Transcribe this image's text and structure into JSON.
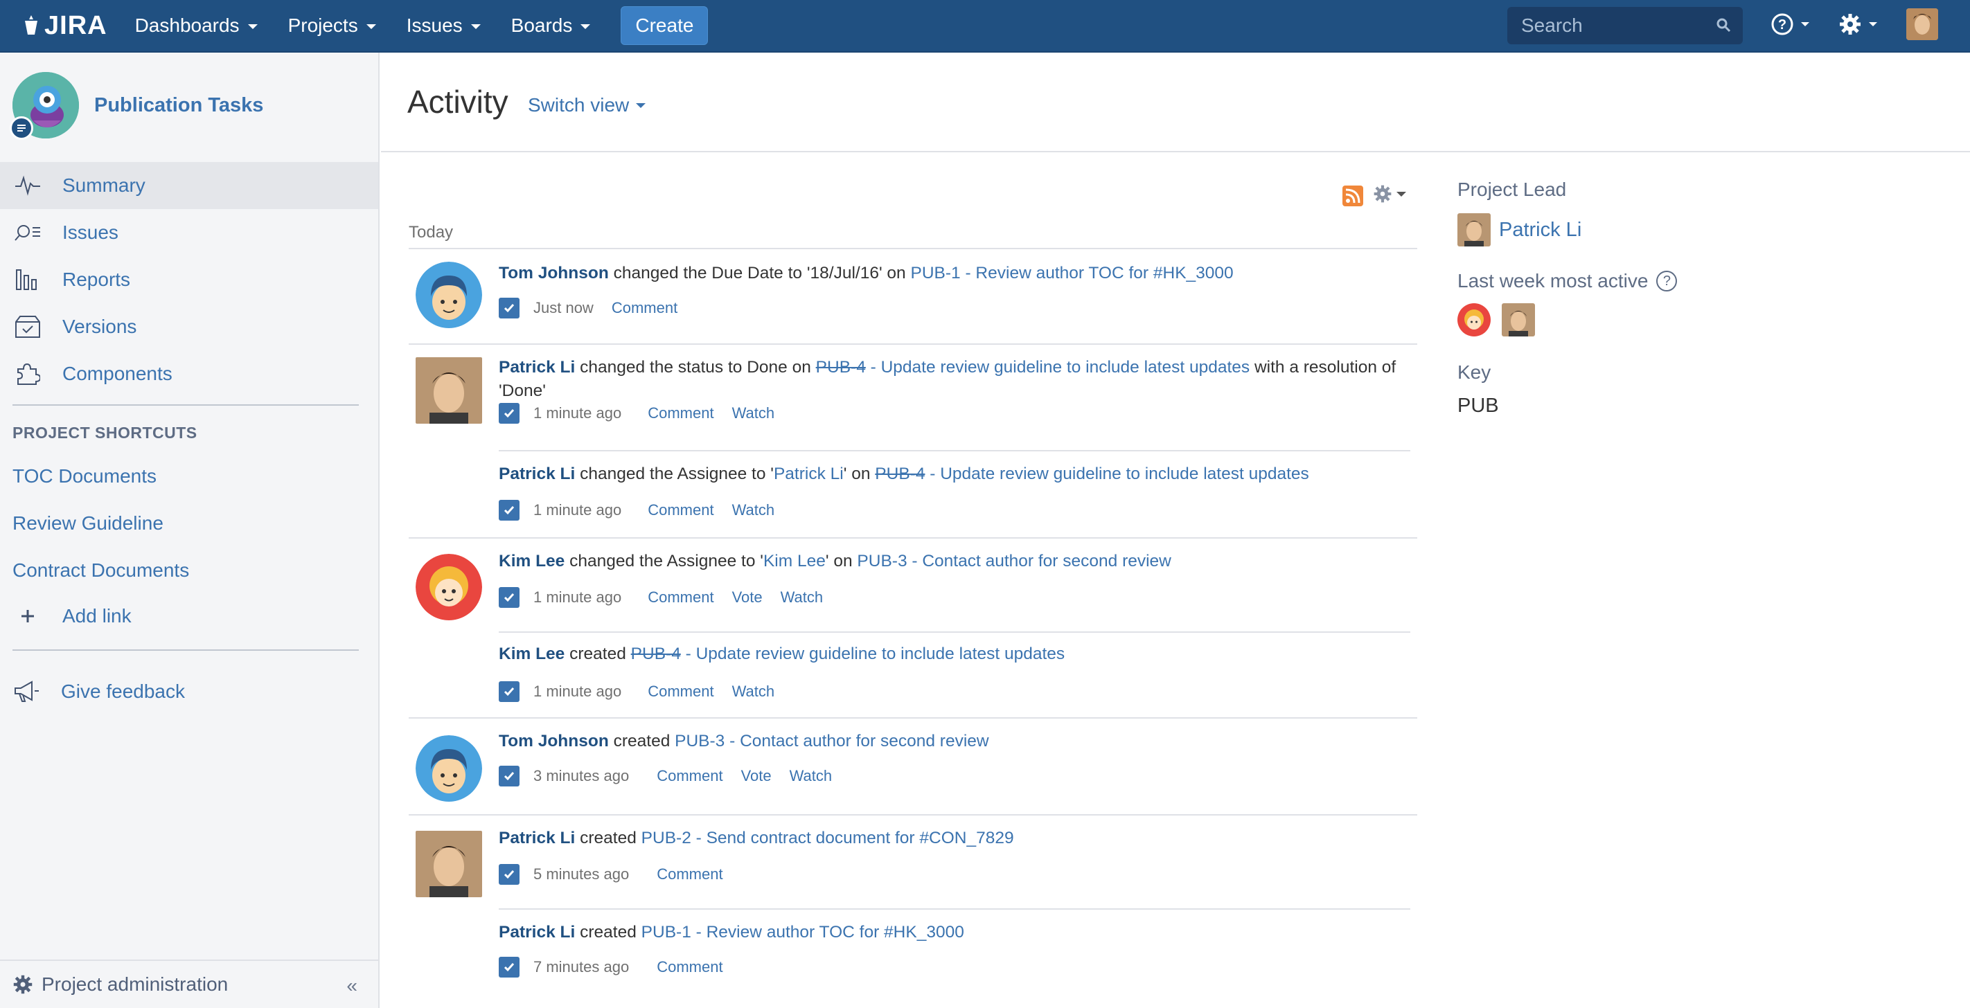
{
  "topbar": {
    "logo_text": "JIRA",
    "nav": [
      {
        "label": "Dashboards"
      },
      {
        "label": "Projects"
      },
      {
        "label": "Issues"
      },
      {
        "label": "Boards"
      }
    ],
    "create_label": "Create",
    "search_placeholder": "Search",
    "colors": {
      "bar": "#205081",
      "create": "#3b7fc4"
    }
  },
  "sidebar": {
    "project_name": "Publication Tasks",
    "items": [
      {
        "label": "Summary",
        "icon": "activity-icon"
      },
      {
        "label": "Issues",
        "icon": "issues-search-icon"
      },
      {
        "label": "Reports",
        "icon": "reports-icon"
      },
      {
        "label": "Versions",
        "icon": "versions-icon"
      },
      {
        "label": "Components",
        "icon": "puzzle-icon"
      }
    ],
    "shortcuts_title": "PROJECT SHORTCUTS",
    "shortcuts": [
      {
        "label": "TOC Documents"
      },
      {
        "label": "Review Guideline"
      },
      {
        "label": "Contract Documents"
      }
    ],
    "add_link": "Add link",
    "feedback": "Give feedback",
    "project_admin": "Project administration",
    "collapse": "«"
  },
  "main": {
    "title": "Activity",
    "switch_view": "Switch view",
    "today": "Today",
    "entries": [
      {
        "user": "Tom Johnson",
        "text_before": " changed the Due Date to '18/Jul/16' on ",
        "issue": "PUB-1 - Review author TOC for #HK_3000",
        "text_after": "",
        "time": "Just now",
        "actions": [
          "Comment"
        ]
      },
      {
        "user": "Patrick Li",
        "text_before": " changed the status to Done on ",
        "issue_key": "PUB-4",
        "issue_rest": " - Update review guideline to include latest updates",
        "text_after": " with a resolution of 'Done'",
        "time": "1 minute ago",
        "actions": [
          "Comment",
          "Watch"
        ]
      },
      {
        "user": "Patrick Li",
        "text_before": " changed the Assignee to '",
        "assignee": "Patrick Li",
        "text_mid": "' on ",
        "issue_key": "PUB-4",
        "issue_rest": " - Update review guideline to include latest updates",
        "time": "1 minute ago",
        "actions": [
          "Comment",
          "Watch"
        ]
      },
      {
        "user": "Kim Lee",
        "text_before": " changed the Assignee to '",
        "assignee": "Kim Lee",
        "text_mid": "' on ",
        "issue": "PUB-3 - Contact author for second review",
        "time": "1 minute ago",
        "actions": [
          "Comment",
          "Vote",
          "Watch"
        ]
      },
      {
        "user": "Kim Lee",
        "text_before": " created ",
        "issue_key": "PUB-4",
        "issue_rest": " - Update review guideline to include latest updates",
        "time": "1 minute ago",
        "actions": [
          "Comment",
          "Watch"
        ]
      },
      {
        "user": "Tom Johnson",
        "text_before": " created ",
        "issue": "PUB-3 - Contact author for second review",
        "time": "3 minutes ago",
        "actions": [
          "Comment",
          "Vote",
          "Watch"
        ]
      },
      {
        "user": "Patrick Li",
        "text_before": " created ",
        "issue": "PUB-2 - Send contract document for #CON_7829",
        "time": "5 minutes ago",
        "actions": [
          "Comment"
        ]
      },
      {
        "user": "Patrick Li",
        "text_before": " created ",
        "issue": "PUB-1 - Review author TOC for #HK_3000",
        "time": "7 minutes ago",
        "actions": [
          "Comment"
        ]
      }
    ]
  },
  "right": {
    "lead_label": "Project Lead",
    "lead_name": "Patrick Li",
    "active_label": "Last week most active",
    "key_label": "Key",
    "key_value": "PUB"
  }
}
